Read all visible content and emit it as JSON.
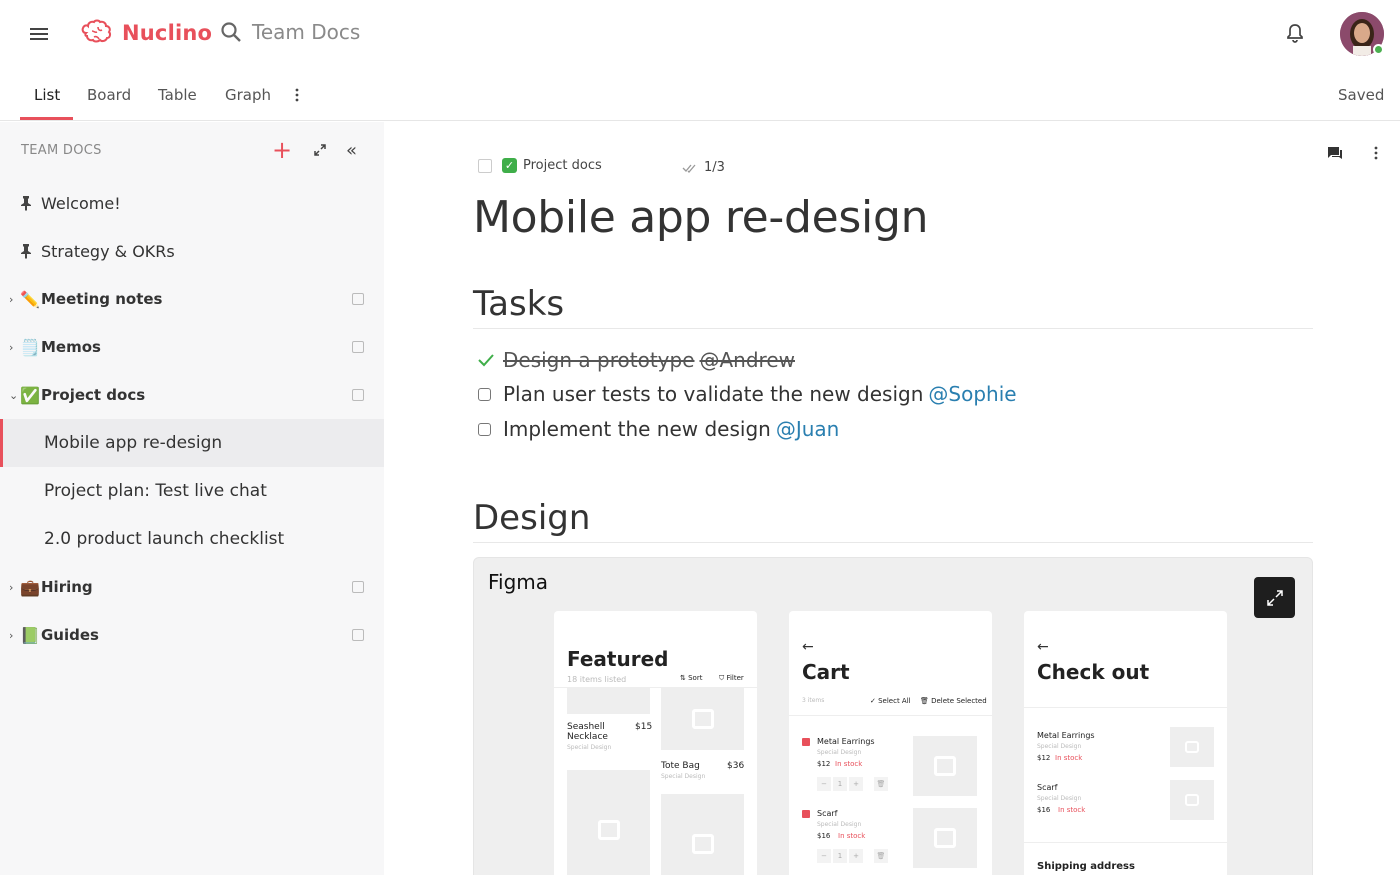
{
  "app": {
    "brand": "Nuclino",
    "search_placeholder": "Team Docs",
    "brand_color": "#e8505b"
  },
  "tabs": [
    {
      "label": "List",
      "active": true
    },
    {
      "label": "Board",
      "active": false
    },
    {
      "label": "Table",
      "active": false
    },
    {
      "label": "Graph",
      "active": false
    }
  ],
  "status": "Saved",
  "sidebar": {
    "header": "TEAM DOCS",
    "items": [
      {
        "label": "Welcome!",
        "icon": "pin-icon",
        "pinned": true
      },
      {
        "label": "Strategy & OKRs",
        "icon": "pin-icon",
        "pinned": true
      },
      {
        "label": "Meeting notes",
        "emoji": "✏️",
        "collapsed": true
      },
      {
        "label": "Memos",
        "emoji": "🗒️",
        "collapsed": true
      },
      {
        "label": "Project docs",
        "emoji": "✅",
        "collapsed": false
      },
      {
        "label": "Mobile app re-design",
        "child": true,
        "active": true
      },
      {
        "label": "Project plan: Test live chat",
        "child": true
      },
      {
        "label": "2.0 product launch checklist",
        "child": true
      },
      {
        "label": "Hiring",
        "emoji": "💼",
        "collapsed": true
      },
      {
        "label": "Guides",
        "emoji": "📗",
        "collapsed": true
      }
    ]
  },
  "document": {
    "breadcrumb": "Project docs",
    "breadcrumb_emoji": "✓",
    "progress": "1/3",
    "title": "Mobile app re-design",
    "tasks_heading": "Tasks",
    "tasks": [
      {
        "text": "Design a prototype",
        "mention": "@Andrew",
        "done": true
      },
      {
        "text": "Plan user tests to validate the new design",
        "mention": "@Sophie",
        "done": false
      },
      {
        "text": "Implement the new design",
        "mention": "@Juan",
        "done": false
      }
    ],
    "design_heading": "Design"
  },
  "figma": {
    "label": "Figma",
    "featured": {
      "title": "Featured",
      "count": "18 items listed",
      "sort": "⇅ Sort",
      "filter": "⛉ Filter",
      "p1_name": "Seashell Necklace",
      "p1_price": "$15",
      "p1_sub": "Special Design",
      "p2_name": "Tote Bag",
      "p2_price": "$36",
      "p2_sub": "Special Design"
    },
    "cart": {
      "title": "Cart",
      "count": "3 items",
      "select_all": "✓ Select All",
      "delete": "🗑 Delete Selected",
      "i1_name": "Metal Earrings",
      "i1_sub": "Special Design",
      "i1_price": "$12",
      "i1_stock": "In stock",
      "i2_name": "Scarf",
      "i2_sub": "Special Design",
      "i2_price": "$16",
      "i2_stock": "In stock",
      "qty": "1"
    },
    "checkout": {
      "title": "Check out",
      "i1_name": "Metal Earrings",
      "i1_sub": "Special Design",
      "i1_price": "$12",
      "i1_stock": "In stock",
      "i2_name": "Scarf",
      "i2_sub": "Special Design",
      "i2_price": "$16",
      "i2_stock": "In stock",
      "shipping": "Shipping address"
    }
  }
}
